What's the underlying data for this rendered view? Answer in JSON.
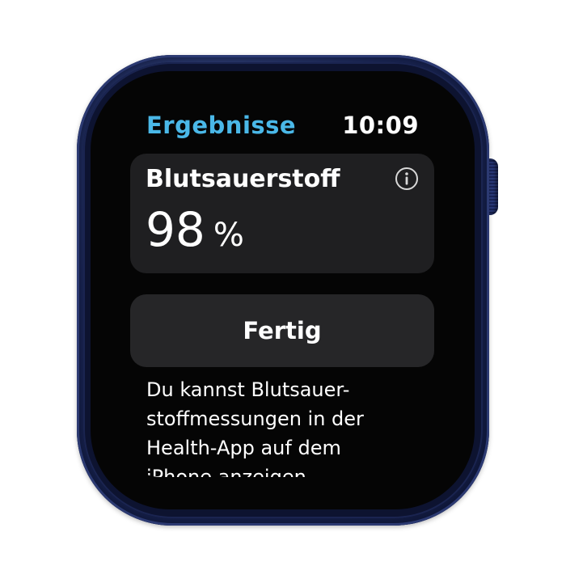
{
  "watch": {
    "case_color": "#1f2b5c",
    "crown_icon": "digital-crown"
  },
  "screen": {
    "title": "Ergebnisse",
    "time": "10:09",
    "accent_color": "#4ab8e8"
  },
  "result_card": {
    "label": "Blutsauerstoff",
    "value": "98",
    "unit": "%",
    "info_icon": "info-circle-icon"
  },
  "done_button": {
    "label": "Fertig"
  },
  "info_text": {
    "lines": [
      "Du kannst Blutsauer-",
      "stoffmessungen in der",
      "Health-App auf dem",
      "iPhone anzeigen."
    ]
  }
}
